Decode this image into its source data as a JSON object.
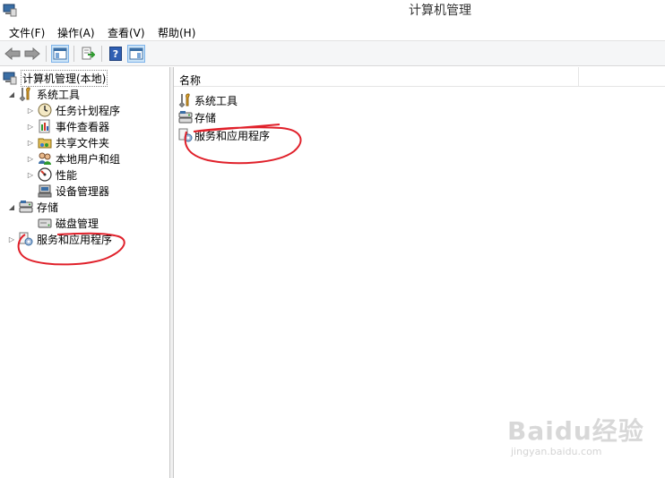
{
  "window": {
    "title": "计算机管理"
  },
  "menu": [
    {
      "label": "文件(F)"
    },
    {
      "label": "操作(A)"
    },
    {
      "label": "查看(V)"
    },
    {
      "label": "帮助(H)"
    }
  ],
  "toolbar": {
    "buttons": [
      "back-icon",
      "forward-icon",
      "show-hide-tree-icon",
      "export-list-icon",
      "help-icon",
      "show-hide-action-pane-icon"
    ]
  },
  "tree": {
    "root": {
      "label": "计算机管理(本地)",
      "icon": "computer-management-icon"
    },
    "system_tools": {
      "label": "系统工具",
      "icon": "tools-icon",
      "children": [
        {
          "label": "任务计划程序",
          "icon": "clock-icon"
        },
        {
          "label": "事件查看器",
          "icon": "event-viewer-icon"
        },
        {
          "label": "共享文件夹",
          "icon": "shared-folder-icon"
        },
        {
          "label": "本地用户和组",
          "icon": "users-icon"
        },
        {
          "label": "性能",
          "icon": "performance-icon"
        },
        {
          "label": "设备管理器",
          "icon": "device-manager-icon"
        }
      ]
    },
    "storage": {
      "label": "存储",
      "icon": "storage-icon",
      "children": [
        {
          "label": "磁盘管理",
          "icon": "disk-icon"
        }
      ]
    },
    "services": {
      "label": "服务和应用程序",
      "icon": "services-icon"
    }
  },
  "list": {
    "column_name": "名称",
    "items": [
      {
        "label": "系统工具",
        "icon": "tools-icon"
      },
      {
        "label": "存储",
        "icon": "storage-icon"
      },
      {
        "label": "服务和应用程序",
        "icon": "services-icon"
      }
    ]
  },
  "watermark": {
    "main": "Baidu经验",
    "sub": "jingyan.baidu.com"
  },
  "colors": {
    "annotation": "#e0202a",
    "selection": "#cce4f7"
  }
}
